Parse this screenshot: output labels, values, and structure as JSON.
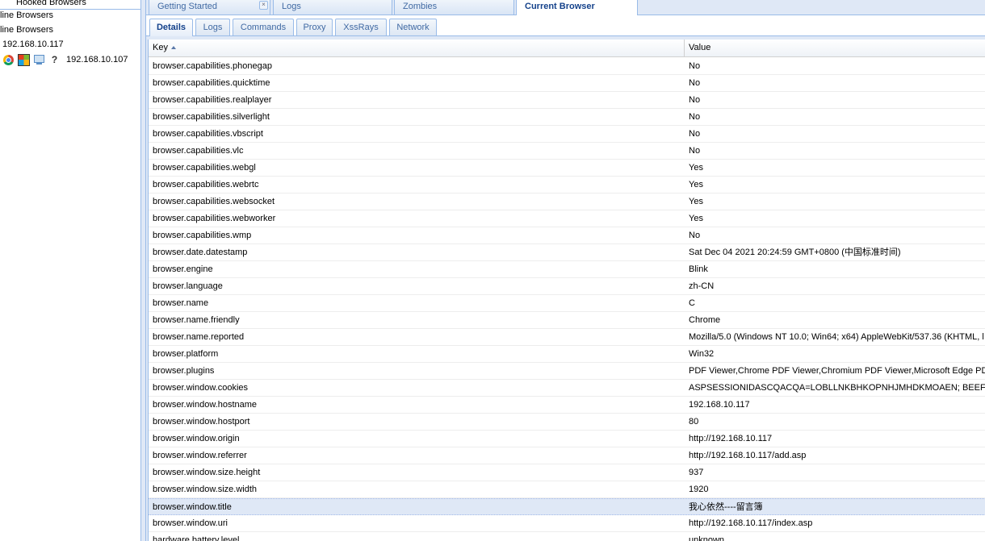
{
  "sidebar": {
    "root_label": "Hooked Browsers",
    "online_label": "line Browsers",
    "offline_label": "line Browsers",
    "host_label": "192.168.10.117",
    "browser_ip": "192.168.10.107",
    "browser_icons": [
      "chrome-icon",
      "windows-icon",
      "computer-icon",
      "question-icon"
    ],
    "unknown_symbol": "?"
  },
  "top_tabs": [
    {
      "label": "Getting Started",
      "closable": true
    },
    {
      "label": "Logs"
    },
    {
      "label": "Zombies"
    },
    {
      "label": "Current Browser",
      "active": true
    }
  ],
  "close_symbol": "×",
  "sub_tabs": [
    {
      "label": "Details",
      "active": true
    },
    {
      "label": "Logs"
    },
    {
      "label": "Commands"
    },
    {
      "label": "Proxy"
    },
    {
      "label": "XssRays"
    },
    {
      "label": "Network"
    }
  ],
  "grid": {
    "columns": {
      "key": "Key",
      "value": "Value"
    },
    "sort": "ascending",
    "selected_row": 26,
    "rows": [
      {
        "key": "browser.capabilities.phonegap",
        "value": "No"
      },
      {
        "key": "browser.capabilities.quicktime",
        "value": "No"
      },
      {
        "key": "browser.capabilities.realplayer",
        "value": "No"
      },
      {
        "key": "browser.capabilities.silverlight",
        "value": "No"
      },
      {
        "key": "browser.capabilities.vbscript",
        "value": "No"
      },
      {
        "key": "browser.capabilities.vlc",
        "value": "No"
      },
      {
        "key": "browser.capabilities.webgl",
        "value": "Yes"
      },
      {
        "key": "browser.capabilities.webrtc",
        "value": "Yes"
      },
      {
        "key": "browser.capabilities.websocket",
        "value": "Yes"
      },
      {
        "key": "browser.capabilities.webworker",
        "value": "Yes"
      },
      {
        "key": "browser.capabilities.wmp",
        "value": "No"
      },
      {
        "key": "browser.date.datestamp",
        "value": "Sat Dec 04 2021 20:24:59 GMT+0800 (中国标准时间)"
      },
      {
        "key": "browser.engine",
        "value": "Blink"
      },
      {
        "key": "browser.language",
        "value": "zh-CN"
      },
      {
        "key": "browser.name",
        "value": "C"
      },
      {
        "key": "browser.name.friendly",
        "value": "Chrome"
      },
      {
        "key": "browser.name.reported",
        "value": "Mozilla/5.0 (Windows NT 10.0; Win64; x64) AppleWebKit/537.36 (KHTML, l"
      },
      {
        "key": "browser.platform",
        "value": "Win32"
      },
      {
        "key": "browser.plugins",
        "value": "PDF Viewer,Chrome PDF Viewer,Chromium PDF Viewer,Microsoft Edge PD"
      },
      {
        "key": "browser.window.cookies",
        "value": "ASPSESSIONIDASCQACQA=LOBLLNKBHKOPNHJMHDKMOAEN; BEEF"
      },
      {
        "key": "browser.window.hostname",
        "value": "192.168.10.117"
      },
      {
        "key": "browser.window.hostport",
        "value": "80"
      },
      {
        "key": "browser.window.origin",
        "value": "http://192.168.10.117"
      },
      {
        "key": "browser.window.referrer",
        "value": "http://192.168.10.117/add.asp"
      },
      {
        "key": "browser.window.size.height",
        "value": "937"
      },
      {
        "key": "browser.window.size.width",
        "value": "1920"
      },
      {
        "key": "browser.window.title",
        "value": "我心依然----留言簿"
      },
      {
        "key": "browser.window.uri",
        "value": "http://192.168.10.117/index.asp"
      },
      {
        "key": "hardware.battery.level",
        "value": "unknown"
      }
    ]
  }
}
